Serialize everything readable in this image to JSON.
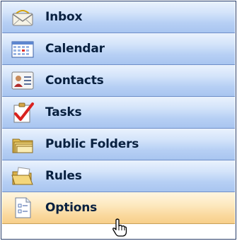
{
  "nav": {
    "items": [
      {
        "label": "Inbox",
        "icon": "inbox-envelope-icon"
      },
      {
        "label": "Calendar",
        "icon": "calendar-icon"
      },
      {
        "label": "Contacts",
        "icon": "contacts-card-icon"
      },
      {
        "label": "Tasks",
        "icon": "tasks-checkmark-icon"
      },
      {
        "label": "Public Folders",
        "icon": "public-folders-icon"
      },
      {
        "label": "Rules",
        "icon": "rules-folder-icon"
      },
      {
        "label": "Options",
        "icon": "options-document-icon",
        "selected": true
      }
    ]
  },
  "colors": {
    "item_bg": "#b6cff4",
    "selected_bg": "#fad89d",
    "label_text": "#08203f",
    "border": "#2a3f6b"
  },
  "cursor": {
    "icon": "hand-pointer-icon"
  }
}
